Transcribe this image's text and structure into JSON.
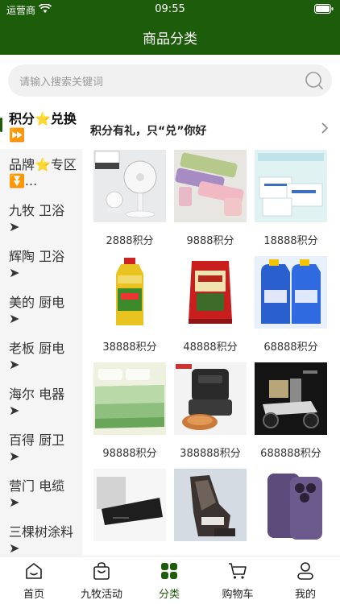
{
  "status": {
    "carrier": "运营商",
    "time": "09:55"
  },
  "header": {
    "title": "商品分类"
  },
  "search": {
    "placeholder": "请输入搜索关键词"
  },
  "sidebar": {
    "items": [
      {
        "label": "积分⭐兑换⏩",
        "active": true
      },
      {
        "label": "品牌⭐专区 ⏬...",
        "active": false
      },
      {
        "label": "九牧 卫浴 ➤",
        "active": false
      },
      {
        "label": "辉陶 卫浴 ➤",
        "active": false
      },
      {
        "label": "美的 厨电 ➤",
        "active": false
      },
      {
        "label": "老板 厨电 ➤",
        "active": false
      },
      {
        "label": "海尔 电器 ➤",
        "active": false
      },
      {
        "label": "百得 厨卫 ➤",
        "active": false
      },
      {
        "label": "营门 电缆 ➤",
        "active": false
      },
      {
        "label": "三棵树涂料 ➤",
        "active": false
      }
    ]
  },
  "main": {
    "banner_title": "积分有礼，只“兑”你好",
    "products": [
      {
        "label": "2888积分",
        "image": "desk-fan"
      },
      {
        "label": "9888积分",
        "image": "umbrellas"
      },
      {
        "label": "18888积分",
        "image": "tissue-boxes"
      },
      {
        "label": "38888积分",
        "image": "cooking-oil"
      },
      {
        "label": "48888积分",
        "image": "rice-bag"
      },
      {
        "label": "68888积分",
        "image": "laundry-detergent"
      },
      {
        "label": "98888积分",
        "image": "bedding-set"
      },
      {
        "label": "388888积分",
        "image": "air-fryer"
      },
      {
        "label": "688888积分",
        "image": "electric-scooter"
      },
      {
        "label": "",
        "image": "range-hood"
      },
      {
        "label": "",
        "image": "massage-chair"
      },
      {
        "label": "",
        "image": "smartphone"
      }
    ]
  },
  "tabbar": {
    "tabs": [
      {
        "label": "首页",
        "icon": "home-icon"
      },
      {
        "label": "九牧活动",
        "icon": "shopping-bag-icon"
      },
      {
        "label": "分类",
        "icon": "category-grid-icon"
      },
      {
        "label": "购物车",
        "icon": "cart-icon"
      },
      {
        "label": "我的",
        "icon": "user-icon"
      }
    ],
    "active_index": 2
  },
  "colors": {
    "brand": "#1d5c0b",
    "sidebar_bg": "#f5f5f5"
  }
}
